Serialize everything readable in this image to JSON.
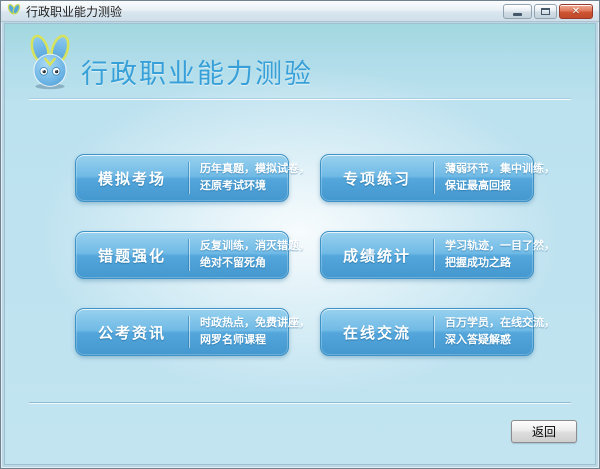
{
  "window": {
    "title": "行政职业能力测验",
    "controls": {
      "minimize": "minimize",
      "maximize": "maximize",
      "close": "close"
    }
  },
  "header": {
    "title": "行政职业能力测验"
  },
  "menu_buttons": [
    {
      "label": "模拟考场",
      "desc_line1": "历年真题，模拟试卷，",
      "desc_line2": "还原考试环境"
    },
    {
      "label": "专项练习",
      "desc_line1": "薄弱环节，集中训练，",
      "desc_line2": "保证最高回报"
    },
    {
      "label": "错题强化",
      "desc_line1": "反复训练，消灭错题，",
      "desc_line2": "绝对不留死角"
    },
    {
      "label": "成绩统计",
      "desc_line1": "学习轨迹，一目了然，",
      "desc_line2": "把握成功之路"
    },
    {
      "label": "公考资讯",
      "desc_line1": "时政热点，免费讲座，",
      "desc_line2": "网罗名师课程"
    },
    {
      "label": "在线交流",
      "desc_line1": "百万学员，在线交流，",
      "desc_line2": "深入答疑解惑"
    }
  ],
  "footer": {
    "back_label": "返回"
  },
  "colors": {
    "header_title": "#38A0D8",
    "button_top": "#98D1EE",
    "button_bottom": "#4398CF",
    "button_border": "#3D92C6",
    "close_button": "#CE5434",
    "background_top": "#A2D7DF",
    "background_main": "#C2E4F1"
  },
  "icons": {
    "app_logo": "rabbit-logo",
    "titlebar_logo": "rabbit-v-logo"
  }
}
